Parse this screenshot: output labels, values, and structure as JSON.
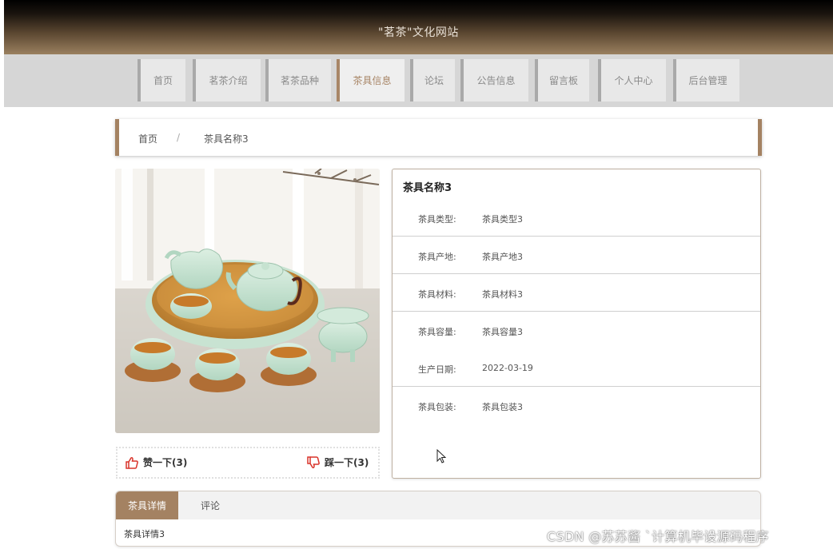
{
  "site": {
    "title": "\"茗茶\"文化网站"
  },
  "nav": {
    "items": [
      {
        "label": "首页"
      },
      {
        "label": "茗茶介绍"
      },
      {
        "label": "茗茶品种"
      },
      {
        "label": "茶具信息"
      },
      {
        "label": "论坛"
      },
      {
        "label": "公告信息"
      },
      {
        "label": "留言板"
      },
      {
        "label": "个人中心"
      },
      {
        "label": "后台管理"
      }
    ],
    "active": "茶具信息"
  },
  "breadcrumb": {
    "home": "首页",
    "separator": "/",
    "current": "茶具名称3"
  },
  "product": {
    "name": "茶具名称3",
    "fields": [
      {
        "label": "茶具类型:",
        "value": "茶具类型3"
      },
      {
        "label": "茶具产地:",
        "value": "茶具产地3"
      },
      {
        "label": "茶具材料:",
        "value": "茶具材料3"
      },
      {
        "label": "茶具容量:",
        "value": "茶具容量3"
      },
      {
        "label": "生产日期:",
        "value": "2022-03-19"
      },
      {
        "label": "茶具包装:",
        "value": "茶具包装3"
      }
    ]
  },
  "votes": {
    "up_label": "赞一下(3)",
    "down_label": "踩一下(3)"
  },
  "tabs": {
    "items": [
      {
        "label": "茶具详情"
      },
      {
        "label": "评论"
      }
    ],
    "content": "茶具详情3"
  },
  "watermark": "CSDN @苏苏酱  `计算机毕设源码程序",
  "colors": {
    "accent": "#a48262",
    "thumb_red": "#d9332a",
    "header_dark": "#000000",
    "nav_bg": "#d6d6d6"
  }
}
